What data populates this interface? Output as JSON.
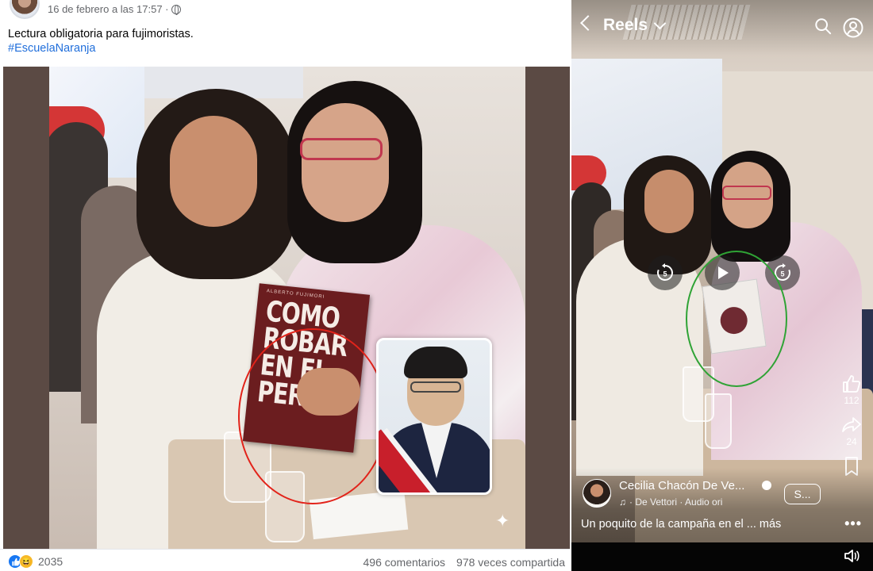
{
  "facebook_post": {
    "timestamp": "16 de febrero a las 17:57 ·",
    "text": "Lectura obligatoria para fujimoristas.",
    "hashtag": "#EscuelaNaranja",
    "image": {
      "book_author": "ALBERTO FUJIMORI",
      "book_title": "COMO ROBAR EN EL PERÚ",
      "highlight_color": "#e2231a"
    },
    "reactions": {
      "icons": [
        "like-icon",
        "haha-icon"
      ],
      "count": "2035"
    },
    "comments": "496 comentarios",
    "shares": "978 veces compartida"
  },
  "reels": {
    "title": "Reels",
    "controls": {
      "rewind_label": "5",
      "forward_label": "5"
    },
    "highlight_color": "#2fa335",
    "actions": {
      "like_count": "112",
      "share_count": "24"
    },
    "author": "Cecilia Chacón De Ve...",
    "follow_label": "S...",
    "audio": "· De Vettori · Audio ori",
    "caption": "Un poquito de la campaña en el ... más",
    "more_label": "•••"
  }
}
